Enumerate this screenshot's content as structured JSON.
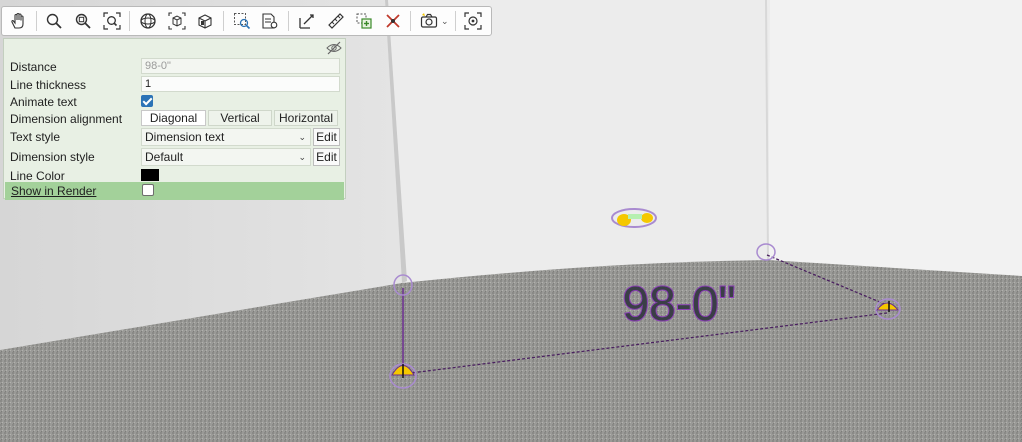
{
  "toolbar": {
    "tools": [
      {
        "icon": "hand-pan-icon"
      },
      {
        "icon": "zoom-icon"
      },
      {
        "icon": "zoom-window-icon"
      },
      {
        "icon": "zoom-extents-icon"
      },
      {
        "icon": "orbit-icon"
      },
      {
        "icon": "view-box-icon"
      },
      {
        "icon": "view-box-3d-icon"
      },
      {
        "icon": "select-window-icon"
      },
      {
        "icon": "select-list-icon"
      },
      {
        "icon": "dimension-tool-icon"
      },
      {
        "icon": "ruler-icon"
      },
      {
        "icon": "add-to-selection-icon"
      },
      {
        "icon": "delete-point-icon"
      },
      {
        "icon": "camera-icon"
      },
      {
        "icon": "center-target-icon"
      }
    ]
  },
  "panel": {
    "distance": {
      "label": "Distance",
      "value": "98-0\""
    },
    "line_thickness": {
      "label": "Line thickness",
      "value": "1"
    },
    "animate_text": {
      "label": "Animate text",
      "checked": true
    },
    "dimension_alignment": {
      "label": "Dimension alignment",
      "options": [
        "Diagonal",
        "Vertical",
        "Horizontal"
      ],
      "selected": "Diagonal"
    },
    "text_style": {
      "label": "Text style",
      "value": "Dimension text",
      "edit_label": "Edit"
    },
    "dimension_style": {
      "label": "Dimension style",
      "value": "Default",
      "edit_label": "Edit"
    },
    "line_color": {
      "label": "Line Color",
      "color": "#000000"
    },
    "show_in_render": {
      "label": "Show in Render",
      "checked": false
    }
  },
  "scene": {
    "dimension_text": "98-0\"",
    "accent": "#8a3fb5",
    "marker_color": "#f5c800"
  }
}
